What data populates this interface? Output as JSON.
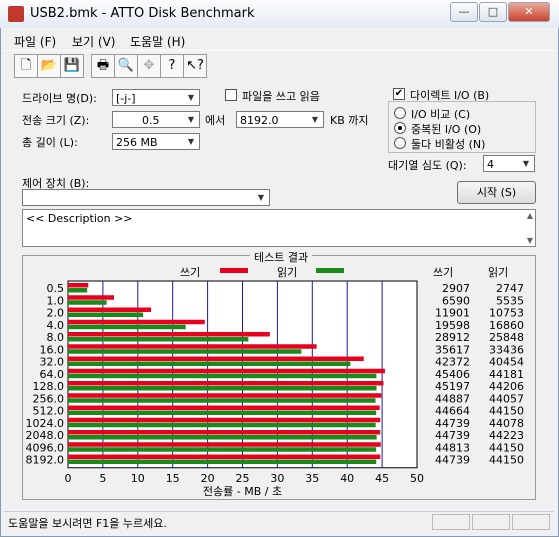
{
  "window": {
    "title": "USB2.bmk - ATTO Disk Benchmark",
    "buttons": {
      "minimize": "—",
      "maximize": "□",
      "close": "✕"
    }
  },
  "menu": [
    "파일 (F)",
    "보기 (V)",
    "도움말 (H)"
  ],
  "toolbar_icons": [
    "new-icon",
    "open-icon",
    "save-icon",
    "print-icon",
    "print-preview-icon",
    "move-icon",
    "help-icon",
    "context-help-icon"
  ],
  "form": {
    "drive_label": "드라이브 명(D):",
    "drive_value": "[-j-]",
    "transfer_label": "전송 크기 (Z):",
    "transfer_from": "0.5",
    "transfer_sep": "에서",
    "transfer_to": "8192.0",
    "transfer_unit": "KB 까지",
    "depth_label": "총 길이 (L):",
    "depth_value": "256 MB",
    "write_read_label": "파일을 쓰고 읽음",
    "direct_io_label": "다이렉트 I/O (B)",
    "io_compare_label": "I/O 비교 (C)",
    "overlapped_io_label": "중복된 I/O (O)",
    "neither_label": "둘다 비활성 (N)",
    "queue_label": "대기열 심도 (Q):",
    "queue_value": "4",
    "control_label": "제어 장치 (B):",
    "control_value": "",
    "start_button": "시작 (S)",
    "description": "<< Description >>"
  },
  "results": {
    "title": "테스트 결과",
    "write_legend": "쓰기",
    "read_legend": "읽기",
    "write_col": "쓰기",
    "read_col": "읽기",
    "write_color": "#e8001c",
    "read_color": "#1a8a1a"
  },
  "chart_data": {
    "type": "bar",
    "orientation": "horizontal",
    "categories": [
      "0.5",
      "1.0",
      "2.0",
      "4.0",
      "8.0",
      "16.0",
      "32.0",
      "64.0",
      "128.0",
      "256.0",
      "512.0",
      "1024.0",
      "2048.0",
      "4096.0",
      "8192.0"
    ],
    "series": [
      {
        "name": "쓰기",
        "values": [
          2907,
          6590,
          11901,
          19598,
          28912,
          35617,
          42372,
          45406,
          45197,
          44887,
          44664,
          44739,
          44739,
          44813,
          44739
        ]
      },
      {
        "name": "읽기",
        "values": [
          2747,
          5535,
          10753,
          16860,
          25848,
          33436,
          40454,
          44181,
          44206,
          44057,
          44150,
          44078,
          44223,
          44150,
          44150
        ]
      }
    ],
    "xlabel": "전송률 - MB / 초",
    "xticks": [
      "0",
      "5",
      "10",
      "15",
      "20",
      "25",
      "30",
      "35",
      "40",
      "45",
      "50"
    ],
    "xlim": [
      0,
      50
    ],
    "grid": true
  },
  "status": "도움말을 보시려면 F1을 누르세요."
}
